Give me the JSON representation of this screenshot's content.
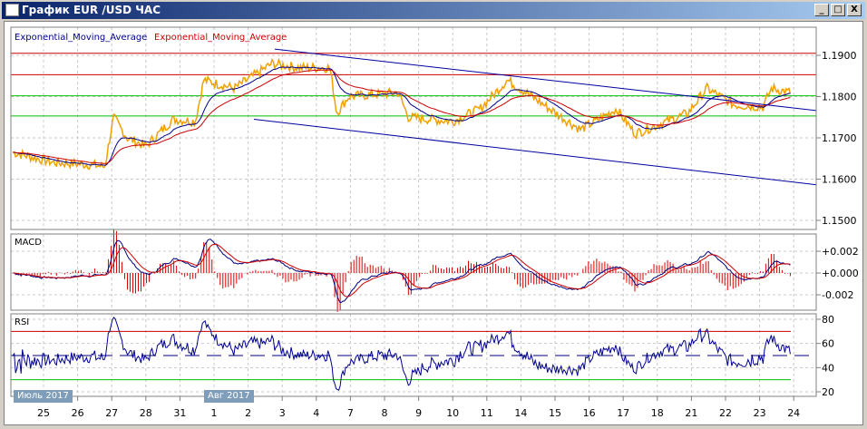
{
  "window": {
    "title": "График EUR /USD  ЧАС",
    "min": "_",
    "max": "□",
    "close": "X"
  },
  "legend": {
    "ema1": "Exponential_Moving_Average",
    "ema2": "Exponential_Moving_Average"
  },
  "panels": {
    "macd": "MACD",
    "rsi": "RSI"
  },
  "month_tags": [
    "Июль 2017",
    "Авг 2017"
  ],
  "colors": {
    "price": "#f0a000",
    "ema_fast": "#00008b",
    "ema_slow": "#cc0000",
    "support": "#00c000",
    "resist": "#cc0000",
    "trend": "#0000a0"
  },
  "chart_data": {
    "type": "line",
    "x_ticks": [
      "25",
      "26",
      "27",
      "28",
      "31",
      "1",
      "2",
      "3",
      "4",
      "7",
      "8",
      "9",
      "10",
      "11",
      "14",
      "15",
      "16",
      "17",
      "18",
      "21",
      "22",
      "23",
      "24"
    ],
    "price_axis": {
      "ticks": [
        "1.1900",
        "1.1800",
        "1.1700",
        "1.1600",
        "1.1500"
      ],
      "values": [
        1.19,
        1.18,
        1.17,
        1.16,
        1.15
      ],
      "ylim": [
        1.148,
        1.1965
      ]
    },
    "macd_axis": {
      "ticks": [
        "+0.002",
        "+0.000",
        "-0.002"
      ],
      "values": [
        0.002,
        0,
        -0.002
      ]
    },
    "rsi_axis": {
      "ticks": [
        "80",
        "60",
        "40",
        "20"
      ],
      "values": [
        80,
        60,
        40,
        20
      ],
      "levels": [
        70,
        30
      ]
    },
    "price_keypoints": [
      [
        -0.9,
        1.1665
      ],
      [
        0.3,
        1.164
      ],
      [
        1.4,
        1.1635
      ],
      [
        1.8,
        1.163
      ],
      [
        2.05,
        1.175
      ],
      [
        2.45,
        1.17
      ],
      [
        3,
        1.168
      ],
      [
        3.8,
        1.1745
      ],
      [
        4.45,
        1.174
      ],
      [
        4.7,
        1.184
      ],
      [
        5.6,
        1.182
      ],
      [
        6.7,
        1.188
      ],
      [
        7.5,
        1.187
      ],
      [
        8.4,
        1.187
      ],
      [
        8.6,
        1.176
      ],
      [
        8.95,
        1.18
      ],
      [
        10.4,
        1.181
      ],
      [
        10.7,
        1.175
      ],
      [
        12,
        1.174
      ],
      [
        12.8,
        1.177
      ],
      [
        13.6,
        1.184
      ],
      [
        14.15,
        1.181
      ],
      [
        15.2,
        1.175
      ],
      [
        15.75,
        1.172
      ],
      [
        16.8,
        1.177
      ],
      [
        17.35,
        1.171
      ],
      [
        18.9,
        1.176
      ],
      [
        19.45,
        1.182
      ],
      [
        20.25,
        1.178
      ],
      [
        21.1,
        1.1775
      ],
      [
        21.35,
        1.182
      ],
      [
        21.9,
        1.181
      ]
    ],
    "horizontal_levels": {
      "resistance": [
        1.1905,
        1.1853
      ],
      "support": [
        1.1802,
        1.1753
      ]
    },
    "trend_lines": [
      [
        [
          6.78,
          1.1915
        ],
        [
          22.8,
          1.1765
        ]
      ],
      [
        [
          6.17,
          1.1745
        ],
        [
          22.8,
          1.1585
        ]
      ]
    ]
  }
}
